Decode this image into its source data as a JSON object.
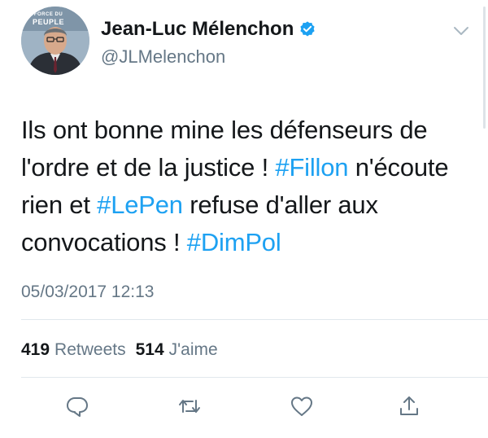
{
  "tweet": {
    "avatar_badge_top": "FORCE DU",
    "avatar_badge_bottom": "PEUPLE",
    "display_name": "Jean-Luc Mélenchon",
    "handle": "@JLMelenchon",
    "verified_icon": "verified-badge-icon",
    "body_lines": [
      [
        {
          "text": "Ils ont bonne mine les défenseurs de",
          "hashtag": false
        }
      ],
      [
        {
          "text": "l'ordre et de la justice ! ",
          "hashtag": false
        },
        {
          "text": "#Fillon",
          "hashtag": true
        },
        {
          "text": " n'écoute",
          "hashtag": false
        }
      ],
      [
        {
          "text": "rien et ",
          "hashtag": false
        },
        {
          "text": "#LePen",
          "hashtag": true
        },
        {
          "text": " refuse d'aller aux",
          "hashtag": false
        }
      ],
      [
        {
          "text": "convocations ! ",
          "hashtag": false
        },
        {
          "text": "#DimPol",
          "hashtag": true
        }
      ]
    ],
    "timestamp": "05/03/2017 12:13",
    "stats": {
      "retweets_count": "419",
      "retweets_label": "Retweets",
      "likes_count": "514",
      "likes_label": "J'aime"
    },
    "actions": [
      "reply-icon",
      "retweet-icon",
      "like-icon",
      "share-icon"
    ],
    "colors": {
      "hashtag": "#1da1f2",
      "secondary_text": "#657786",
      "primary_text": "#14171a"
    }
  }
}
